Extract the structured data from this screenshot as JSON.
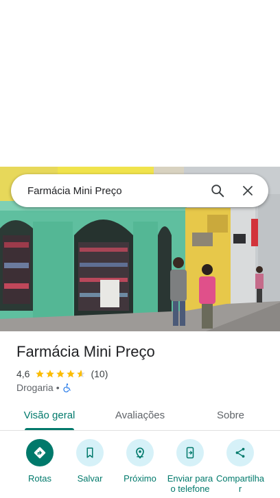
{
  "search": {
    "query": "Farmácia Mini Preço"
  },
  "place": {
    "name": "Farmácia Mini Preço",
    "rating": "4,6",
    "review_count": "(10)",
    "stars_filled": 4.6,
    "category": "Drogaria",
    "separator": "•",
    "accessibility_icon": "wheelchair-icon"
  },
  "tabs": [
    {
      "label": "Visão geral",
      "active": true
    },
    {
      "label": "Avaliações",
      "active": false
    },
    {
      "label": "Sobre",
      "active": false
    }
  ],
  "actions": [
    {
      "label": "Rotas",
      "icon": "directions-icon"
    },
    {
      "label": "Salvar",
      "icon": "bookmark-icon"
    },
    {
      "label": "Próximo",
      "icon": "nearby-icon"
    },
    {
      "label": "Enviar para o telefone",
      "icon": "send-to-phone-icon"
    },
    {
      "label": "Compartilhar",
      "icon": "share-icon"
    }
  ],
  "colors": {
    "accent": "#00796b",
    "action_bg": "#d6f1f8",
    "star": "#fbbc04"
  }
}
